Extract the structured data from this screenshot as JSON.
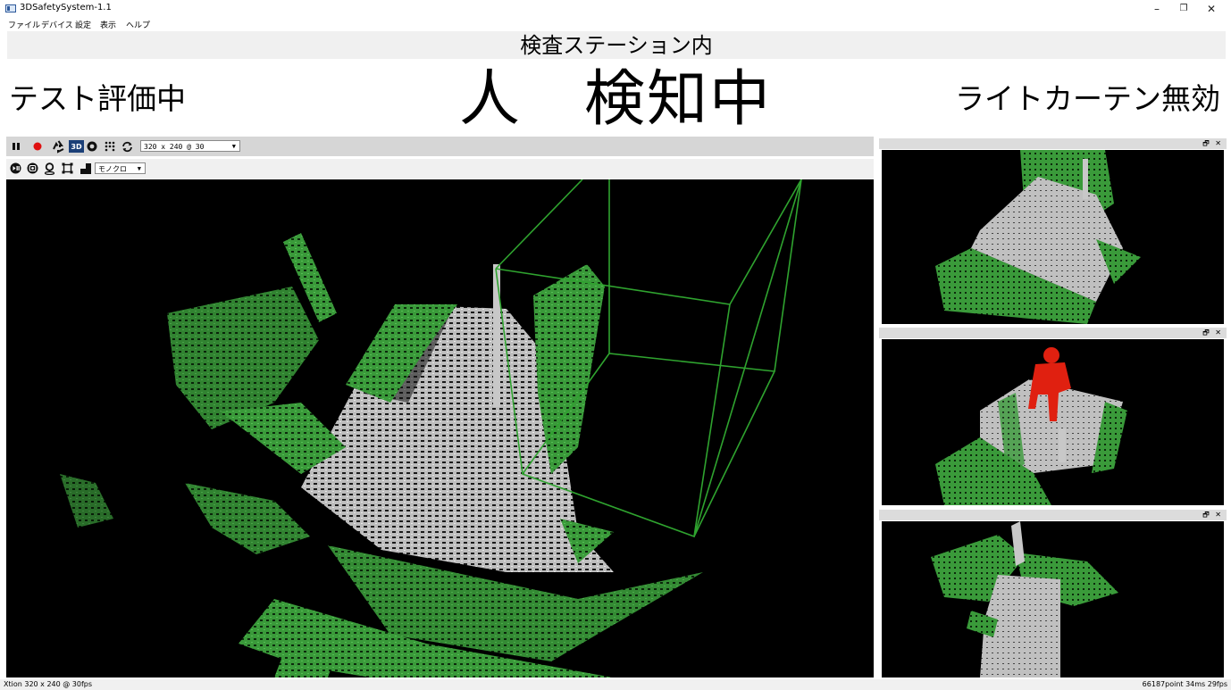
{
  "window": {
    "title": "3DSafetySystem-1.1",
    "minimize": "–",
    "restore": "❐",
    "close": "✕"
  },
  "menu": [
    "ファイル",
    "デバイス",
    "設定",
    "表示",
    "ヘルプ"
  ],
  "station": "検査ステーション内",
  "status": {
    "left": "テスト評価中",
    "center": "人　検知中",
    "right": "ライトカーテン無効"
  },
  "toolbar": {
    "icons": [
      "pause-icon",
      "record-icon",
      "recycle-icon",
      "3d-mode-icon",
      "aperture-icon",
      "points-icon",
      "refresh-icon"
    ],
    "badge_3d": "3D",
    "resolution": "320 x 240 @ 30",
    "icons2": [
      "play-pause-icon",
      "camera-icon",
      "location-icon",
      "crop-icon",
      "contrast-icon"
    ],
    "color_mode": "モノクロ"
  },
  "panel_controls": "🗗 ✕",
  "statusbar": {
    "left": "Xtion  320 x 240 @ 30fps",
    "right": "66187point  34ms  29fps"
  },
  "colors": {
    "cloud_green": "#3a9a3a",
    "cloud_gray": "#c0c0c0",
    "person_red": "#e02010",
    "frame_green": "#2fa32f"
  }
}
